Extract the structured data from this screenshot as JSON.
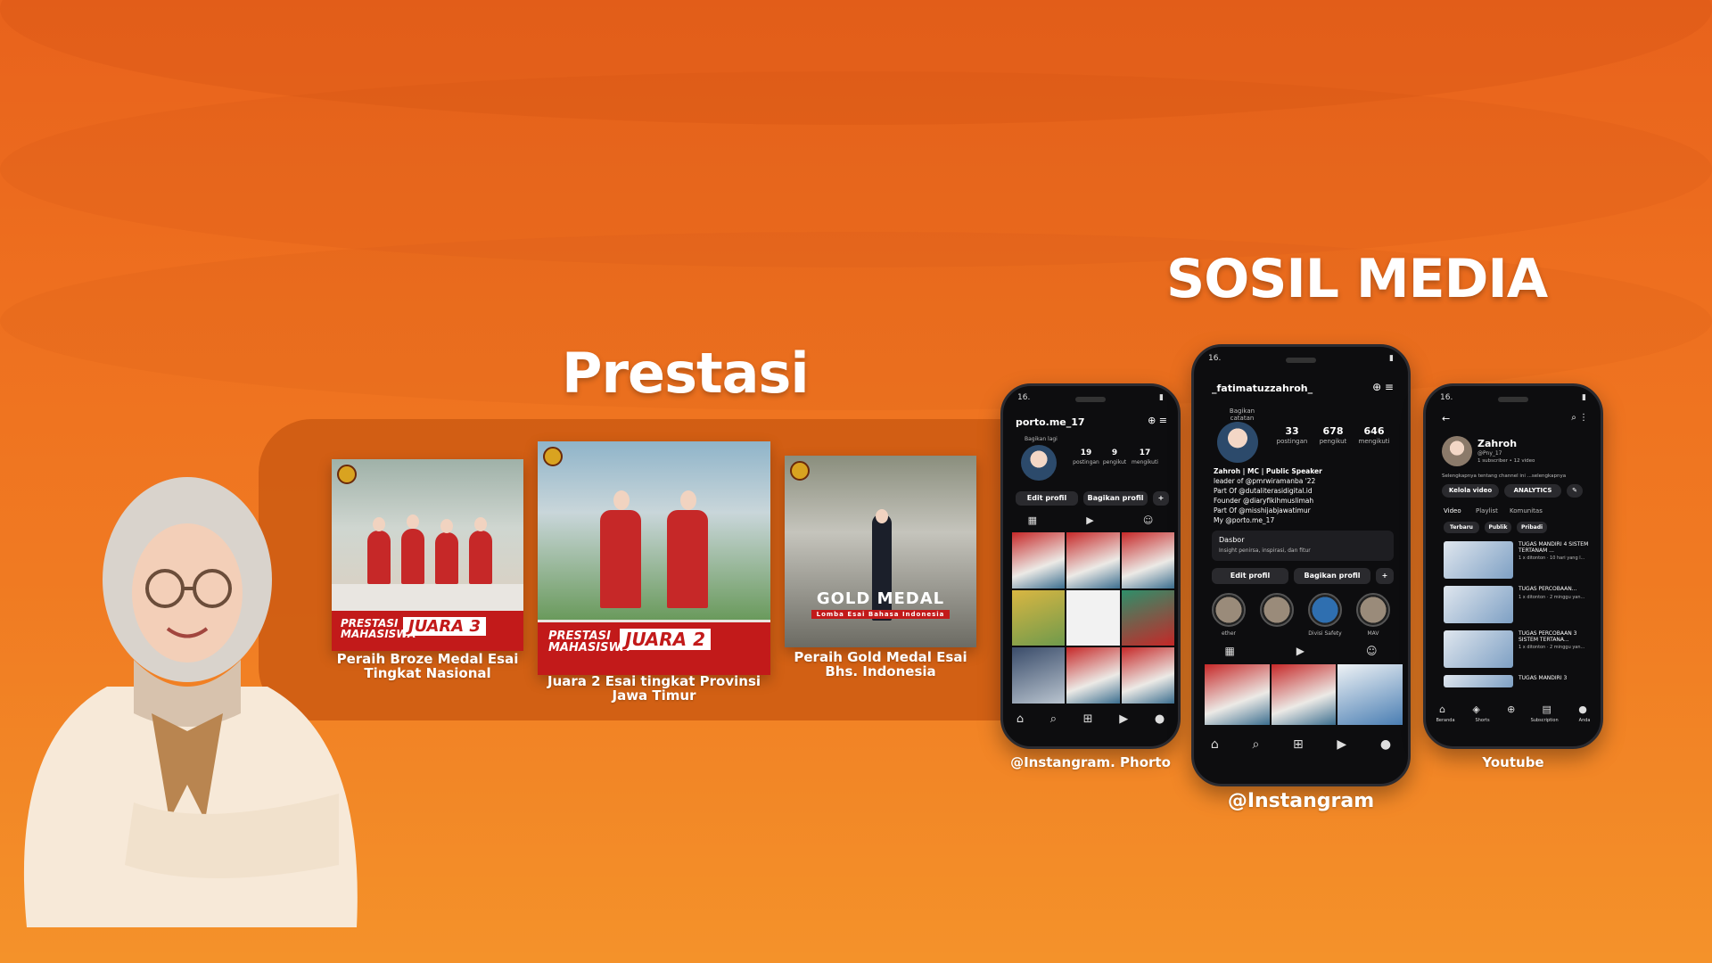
{
  "titles": {
    "prestasi": "Prestasi",
    "social": "SOSIL MEDIA"
  },
  "awards": [
    {
      "caption_line1": "Peraih Broze Medal Esai",
      "caption_line2": "Tingkat Nasional",
      "badge_text": "JUARA 3",
      "band_text_1": "PRESTASI",
      "band_text_2": "MAHASISWA"
    },
    {
      "caption_line1": "Juara 2 Esai tingkat Provinsi",
      "caption_line2": "Jawa Timur",
      "badge_text": "JUARA 2",
      "band_text_1": "PRESTASI",
      "band_text_2": "MAHASISWA"
    },
    {
      "caption_line1": "Peraih Gold Medal Esai",
      "caption_line2": "Bhs. Indonesia",
      "badge_text": "GOLD MEDAL",
      "band_text_1": "Lomba Esai Bahasa Indonesia"
    }
  ],
  "phones": {
    "instagram_photo": {
      "label": "@Instangram. Phorto",
      "time": "16.",
      "username": "porto.me_17",
      "stats": [
        {
          "value": "19",
          "label": "postingan"
        },
        {
          "value": "9",
          "label": "pengikut"
        },
        {
          "value": "17",
          "label": "mengikuti"
        }
      ],
      "edit_btn": "Edit profil",
      "share_btn": "Bagikan profil",
      "note": "Bagikan lagi"
    },
    "instagram_main": {
      "label": "@Instangram",
      "time": "16.",
      "username": "_fatimatuzzahroh_",
      "note": "Bagikan catatan",
      "stats": [
        {
          "value": "33",
          "label": "postingan"
        },
        {
          "value": "678",
          "label": "pengikut"
        },
        {
          "value": "646",
          "label": "mengikuti"
        }
      ],
      "bio": [
        "Zahroh | MC | Public Speaker",
        "leader of @pmrwiramanba '22",
        "Part Of @dutaliterasidigital.id",
        "Founder @diaryfikihmuslimah",
        "Part Of @misshijabjawatimur",
        "My @porto.me_17"
      ],
      "dashboard_title": "Dasbor",
      "dashboard_sub": "Insight penirsa, inspirasi, dan fitur",
      "edit_btn": "Edit profil",
      "share_btn": "Bagikan profil",
      "highlights": [
        "ether",
        "",
        "Divisi Safety",
        "MAV"
      ]
    },
    "youtube": {
      "label": "Youtube",
      "time": "16.",
      "channel": "Zahroh",
      "handle": "@Pny_17",
      "meta": "1 subscriber • 12 video",
      "desc": "Selengkapnya tentang channel ini ...selengkapnya",
      "manage_btn": "Kelola video",
      "analytics_btn": "ANALYTICS",
      "tabs": [
        "Video",
        "Playlist",
        "Komunitas"
      ],
      "filters": [
        "Terbaru",
        "Publik",
        "Pribadi"
      ],
      "videos": [
        {
          "title": "TUGAS MANDIRI 4 SISTEM TERTANAM ...",
          "meta": "1 x ditonton · 10 hari yang l...",
          "duration": "2:57"
        },
        {
          "title": "TUGAS PERCOBAAN...",
          "meta": "1 x ditonton · 2 minggu yan...",
          "duration": "2:09"
        },
        {
          "title": "TUGAS PERCOBAAN 3 SISTEM TERTANA...",
          "meta": "1 x ditonton · 2 minggu yan...",
          "duration": "1:55"
        },
        {
          "title": "TUGAS MANDIRI 3",
          "meta": "",
          "duration": ""
        }
      ],
      "nav": [
        "Beranda",
        "Shorts",
        "",
        "Subscription",
        "Anda"
      ]
    }
  }
}
